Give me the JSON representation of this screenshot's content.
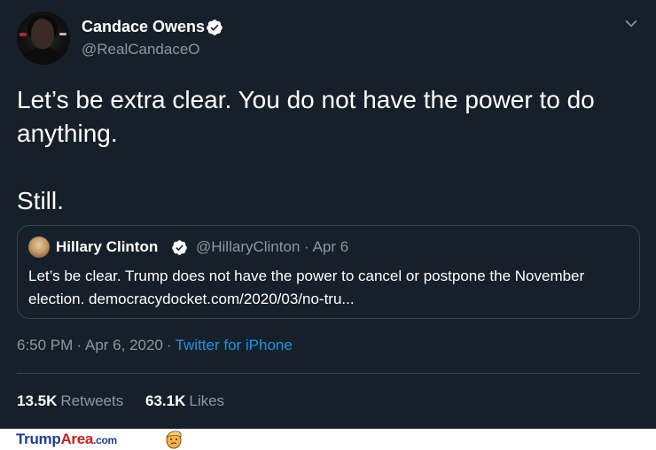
{
  "tweet": {
    "author": {
      "name": "Candace Owens",
      "handle": "@RealCandaceO"
    },
    "text_lines": [
      "Let’s be extra clear. You do not have the power to do anything.",
      "Still."
    ],
    "quoted": {
      "name": "Hillary Clinton",
      "handle_date": "@HillaryClinton · Apr 6",
      "text": "Let’s be clear. Trump does not have the power to cancel or postpone the November election. democracydocket.com/2020/03/no-tru..."
    },
    "meta": {
      "time": "6:50 PM",
      "date": "Apr 6, 2020",
      "source": "Twitter for iPhone"
    },
    "stats": {
      "retweets_count": "13.5K",
      "retweets_label": "Retweets",
      "likes_count": "63.1K",
      "likes_label": "Likes"
    }
  },
  "footer": {
    "brand_part1": "Trump",
    "brand_part2": "Area",
    "brand_part3": ".com"
  },
  "colors": {
    "background": "#15202b",
    "secondary_text": "#8899a6",
    "link": "#1b95e0",
    "border": "#38444d",
    "verified": "#ffffff"
  },
  "icons": {
    "verified": "verified-badge-icon",
    "caret": "chevron-down-icon"
  }
}
